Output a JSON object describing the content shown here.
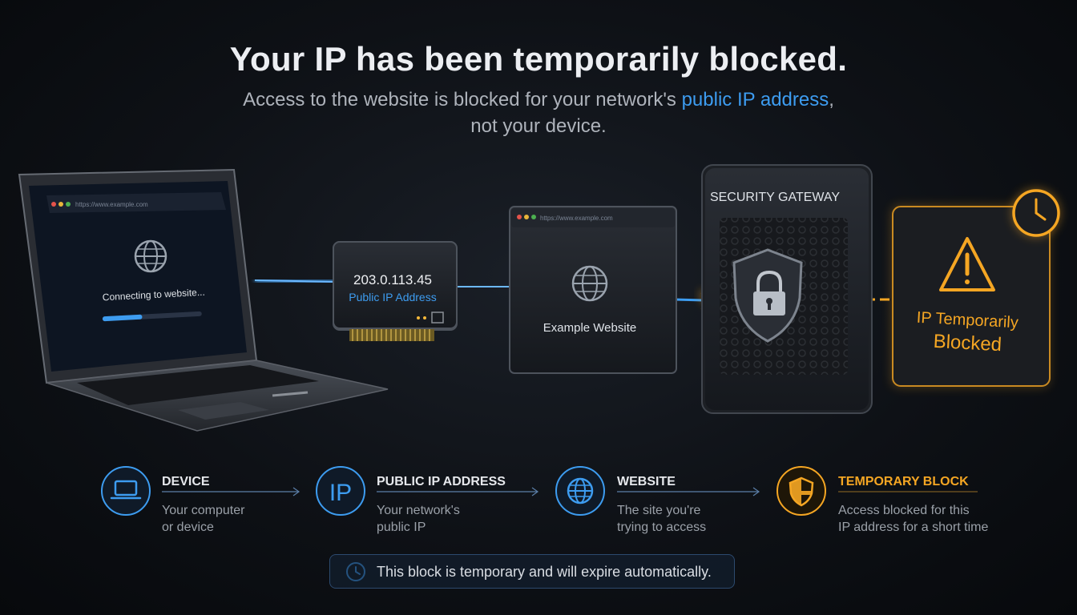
{
  "header": {
    "title": "Your IP has been temporarily blocked.",
    "subtitle_pre": "Access to the website is blocked for your network's ",
    "subtitle_highlight": "public IP address",
    "subtitle_post": ",",
    "subtitle_line2": "not your device."
  },
  "laptop": {
    "url": "https://www.example.com",
    "status": "Connecting to website...",
    "progress": 0.4
  },
  "ip_card": {
    "ip": "203.0.113.45",
    "label": "Public IP Address"
  },
  "website_card": {
    "url": "https://www.example.com",
    "label": "Example Website"
  },
  "gateway": {
    "label": "SECURITY GATEWAY"
  },
  "blocked_card": {
    "line1": "IP Temporarily",
    "line2": "Blocked"
  },
  "steps": [
    {
      "title": "DEVICE",
      "desc1": "Your computer",
      "desc2": "or device",
      "icon": "laptop-icon"
    },
    {
      "title": "PUBLIC IP ADDRESS",
      "desc1": "Your network's",
      "desc2": "public IP",
      "icon": "ip-icon",
      "icon_text": "IP"
    },
    {
      "title": "WEBSITE",
      "desc1": "The site you're",
      "desc2": "trying to access",
      "icon": "globe-icon"
    },
    {
      "title": "TEMPORARY BLOCK",
      "desc1": "Access blocked for this",
      "desc2": "IP address for a short time",
      "icon": "shield-icon"
    }
  ],
  "note": {
    "text": "This block is temporary and will expire automatically."
  },
  "colors": {
    "blue": "#3d9cf0",
    "orange": "#f5a623"
  }
}
